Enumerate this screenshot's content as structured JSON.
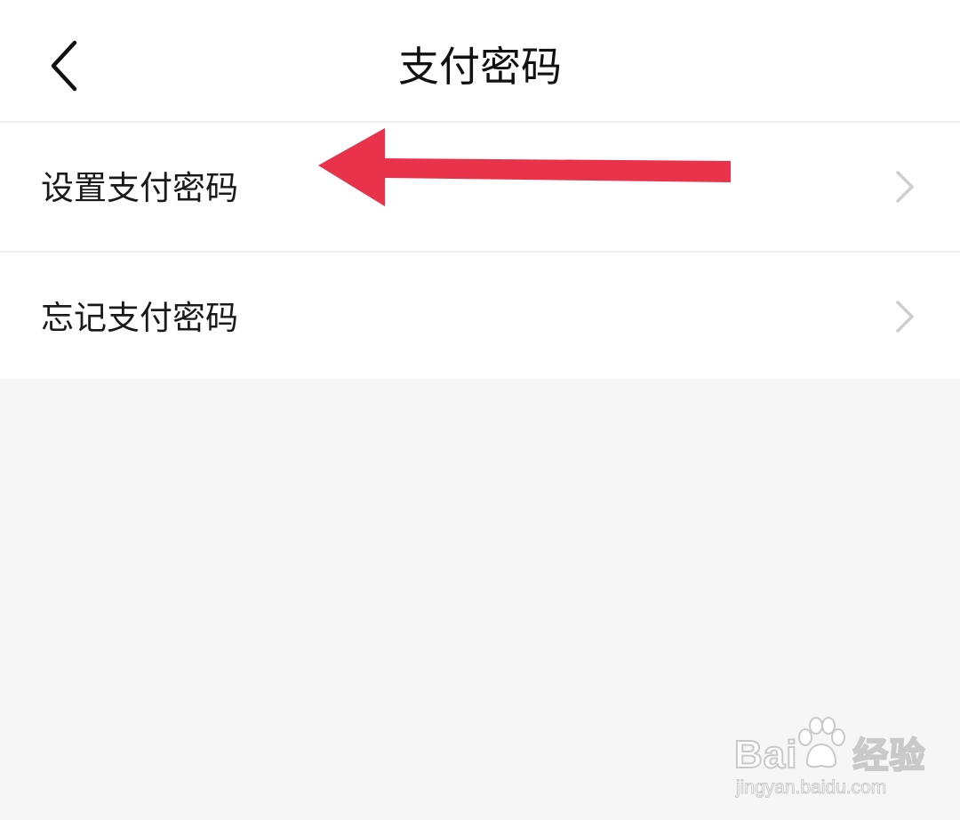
{
  "header": {
    "title": "支付密码",
    "back_icon": "chevron-left-icon"
  },
  "menu": {
    "items": [
      {
        "label": "设置支付密码",
        "icon": "chevron-right-icon"
      },
      {
        "label": "忘记支付密码",
        "icon": "chevron-right-icon"
      }
    ]
  },
  "annotation": {
    "icon": "arrow-left-icon",
    "color": "#e8334a"
  },
  "watermark": {
    "brand_left": "Bai",
    "brand_right": "经验",
    "url": "jingyan.baidu.com"
  },
  "colors": {
    "background": "#f6f6f6",
    "surface": "#ffffff",
    "divider": "#efefef",
    "text": "#111111",
    "chevron": "#cfcfcf",
    "accent": "#e8334a"
  }
}
